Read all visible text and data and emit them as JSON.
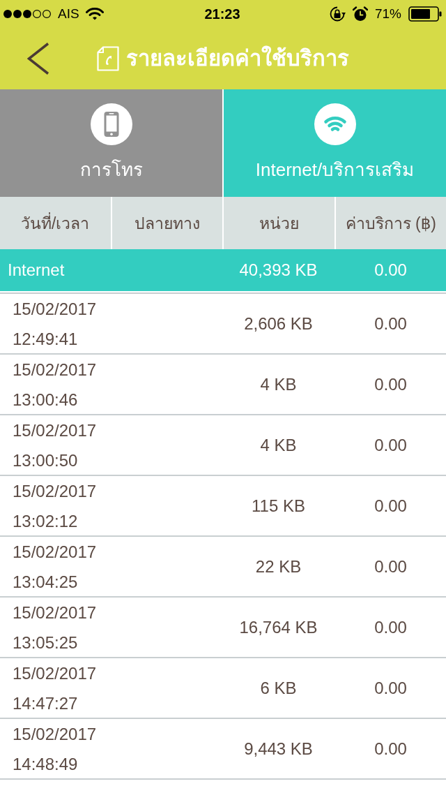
{
  "status_bar": {
    "carrier": "AIS",
    "time": "21:23",
    "battery": "71%"
  },
  "header": {
    "title": "รายละเอียดค่าใช้บริการ"
  },
  "tabs": [
    {
      "label": "การโทร",
      "kind": "phone",
      "selected": false
    },
    {
      "label": "Internet/บริการเสริม",
      "kind": "wifi",
      "selected": true
    }
  ],
  "table": {
    "columns": [
      "วันที่/เวลา",
      "ปลายทาง",
      "หน่วย",
      "ค่าบริการ (฿)"
    ],
    "summary": {
      "label": "Internet",
      "units": "40,393 KB",
      "charge": "0.00"
    },
    "rows": [
      {
        "date": "15/02/2017",
        "time": "12:49:41",
        "units": "2,606 KB",
        "charge": "0.00"
      },
      {
        "date": "15/02/2017",
        "time": "13:00:46",
        "units": "4 KB",
        "charge": "0.00"
      },
      {
        "date": "15/02/2017",
        "time": "13:00:50",
        "units": "4 KB",
        "charge": "0.00"
      },
      {
        "date": "15/02/2017",
        "time": "13:02:12",
        "units": "115 KB",
        "charge": "0.00"
      },
      {
        "date": "15/02/2017",
        "time": "13:04:25",
        "units": "22 KB",
        "charge": "0.00"
      },
      {
        "date": "15/02/2017",
        "time": "13:05:25",
        "units": "16,764 KB",
        "charge": "0.00"
      },
      {
        "date": "15/02/2017",
        "time": "14:47:27",
        "units": "6 KB",
        "charge": "0.00"
      },
      {
        "date": "15/02/2017",
        "time": "14:48:49",
        "units": "9,443 KB",
        "charge": "0.00"
      }
    ]
  }
}
